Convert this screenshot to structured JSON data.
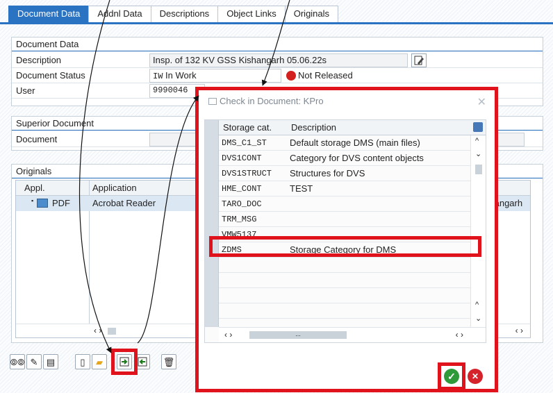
{
  "tabs": [
    {
      "label": "Document Data"
    },
    {
      "label": "Addnl Data"
    },
    {
      "label": "Descriptions"
    },
    {
      "label": "Object Links"
    },
    {
      "label": "Originals"
    }
  ],
  "document_data": {
    "title": "Document Data",
    "description_label": "Description",
    "description_value": "Insp. of 132 KV GSS Kishangarh 05.06.22s",
    "status_label": "Document Status",
    "status_code": "IW",
    "status_text": "In Work",
    "release_text": "Not Released",
    "user_label": "User",
    "user_value": "9990046"
  },
  "superior_document": {
    "title": "Superior Document",
    "document_label": "Document"
  },
  "originals": {
    "title": "Originals",
    "columns": [
      "Appl.",
      "Application"
    ],
    "rows": [
      {
        "appl": "PDF",
        "application": "Acrobat Reader",
        "trailing": "ishangarh"
      }
    ]
  },
  "dialog": {
    "title": "Check in Document: KPro",
    "columns": [
      "Storage cat.",
      "Description"
    ],
    "rows": [
      {
        "code": "DMS_C1_ST",
        "desc": "Default storage DMS (main files)"
      },
      {
        "code": "DVS1CONT",
        "desc": "Category for DVS content objects"
      },
      {
        "code": "DVS1STRUCT",
        "desc": "Structures for DVS"
      },
      {
        "code": "HME_CONT",
        "desc": "TEST"
      },
      {
        "code": "TARO_DOC",
        "desc": ""
      },
      {
        "code": "TRM_MSG",
        "desc": ""
      },
      {
        "code": "VMW5137",
        "desc": ""
      },
      {
        "code": "ZDMS",
        "desc": "Storage Category for DMS"
      }
    ],
    "hscroll_dots": "..."
  },
  "icons": {
    "close": "close-icon",
    "ok": "checkmark-icon",
    "cancel": "cancel-icon"
  },
  "colors": {
    "accent": "#2a73c2",
    "highlight_red": "#e0121b",
    "ok_green": "#2f9a3a",
    "cancel_red": "#d4232b"
  }
}
